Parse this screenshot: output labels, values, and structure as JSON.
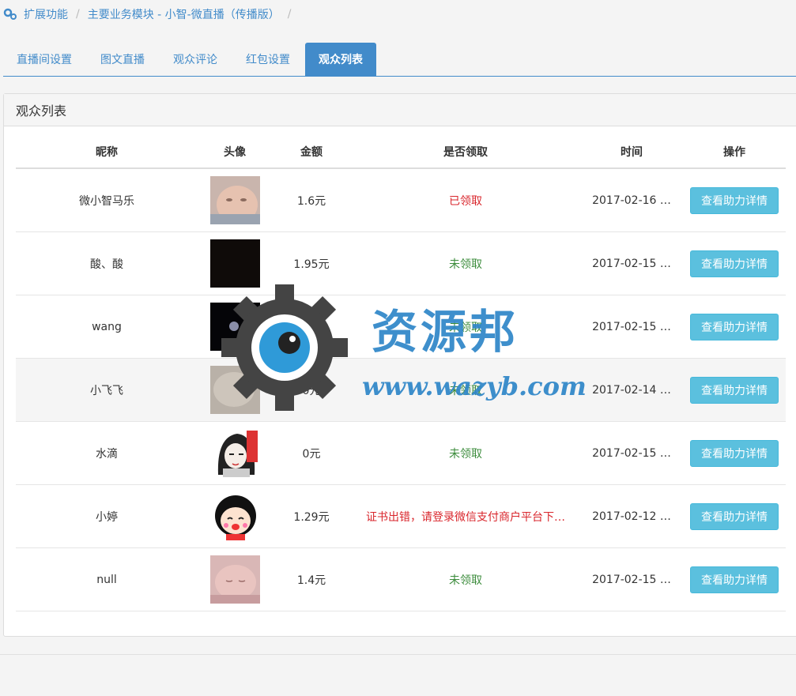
{
  "breadcrumb": {
    "items": [
      "扩展功能",
      "主要业务模块 - 小智-微直播（传播版）"
    ],
    "separator": "/"
  },
  "tabs": [
    {
      "label": "直播间设置",
      "active": false
    },
    {
      "label": "图文直播",
      "active": false
    },
    {
      "label": "观众评论",
      "active": false
    },
    {
      "label": "红包设置",
      "active": false
    },
    {
      "label": "观众列表",
      "active": true
    }
  ],
  "panel": {
    "title": "观众列表"
  },
  "table": {
    "headers": [
      "昵称",
      "头像",
      "金额",
      "是否领取",
      "时间",
      "操作"
    ],
    "rows": [
      {
        "nickname": "微小智马乐",
        "avatar": "baby-photo",
        "amount": "1.6元",
        "status": "已领取",
        "status_color": "#d9262c",
        "time": "2017-02-16 …",
        "action": "查看助力详情",
        "highlight": false
      },
      {
        "nickname": "酸、酸",
        "avatar": "dark-photo",
        "amount": "1.95元",
        "status": "未领取",
        "status_color": "#3c8c3c",
        "time": "2017-02-15 …",
        "action": "查看助力详情",
        "highlight": false
      },
      {
        "nickname": "wang",
        "avatar": "moon-photo",
        "amount": "元",
        "status": "未领取",
        "status_color": "#3c8c3c",
        "time": "2017-02-15 …",
        "action": "查看助力详情",
        "highlight": false
      },
      {
        "nickname": "小飞飞",
        "avatar": "blurry-photo",
        "amount": "0元",
        "status": "未领取",
        "status_color": "#3c8c3c",
        "time": "2017-02-14 …",
        "action": "查看助力详情",
        "highlight": true
      },
      {
        "nickname": "水滴",
        "avatar": "anime-avatar",
        "amount": "0元",
        "status": "未领取",
        "status_color": "#3c8c3c",
        "time": "2017-02-15 …",
        "action": "查看助力详情",
        "highlight": false
      },
      {
        "nickname": "小婷",
        "avatar": "cartoon-girl",
        "amount": "1.29元",
        "status": "证书出错，请登录微信支付商户平台下…",
        "status_color": "#d9262c",
        "time": "2017-02-12 …",
        "action": "查看助力详情",
        "highlight": false
      },
      {
        "nickname": "null",
        "avatar": "baby-sleeping-photo",
        "amount": "1.4元",
        "status": "未领取",
        "status_color": "#3c8c3c",
        "time": "2017-02-15 …",
        "action": "查看助力详情",
        "highlight": false
      }
    ]
  },
  "watermark": {
    "title": "资源邦",
    "url": "www.wazyb.com"
  },
  "colors": {
    "primary": "#428bca",
    "info": "#5bc0de",
    "danger": "#d9262c",
    "success": "#3c8c3c"
  }
}
